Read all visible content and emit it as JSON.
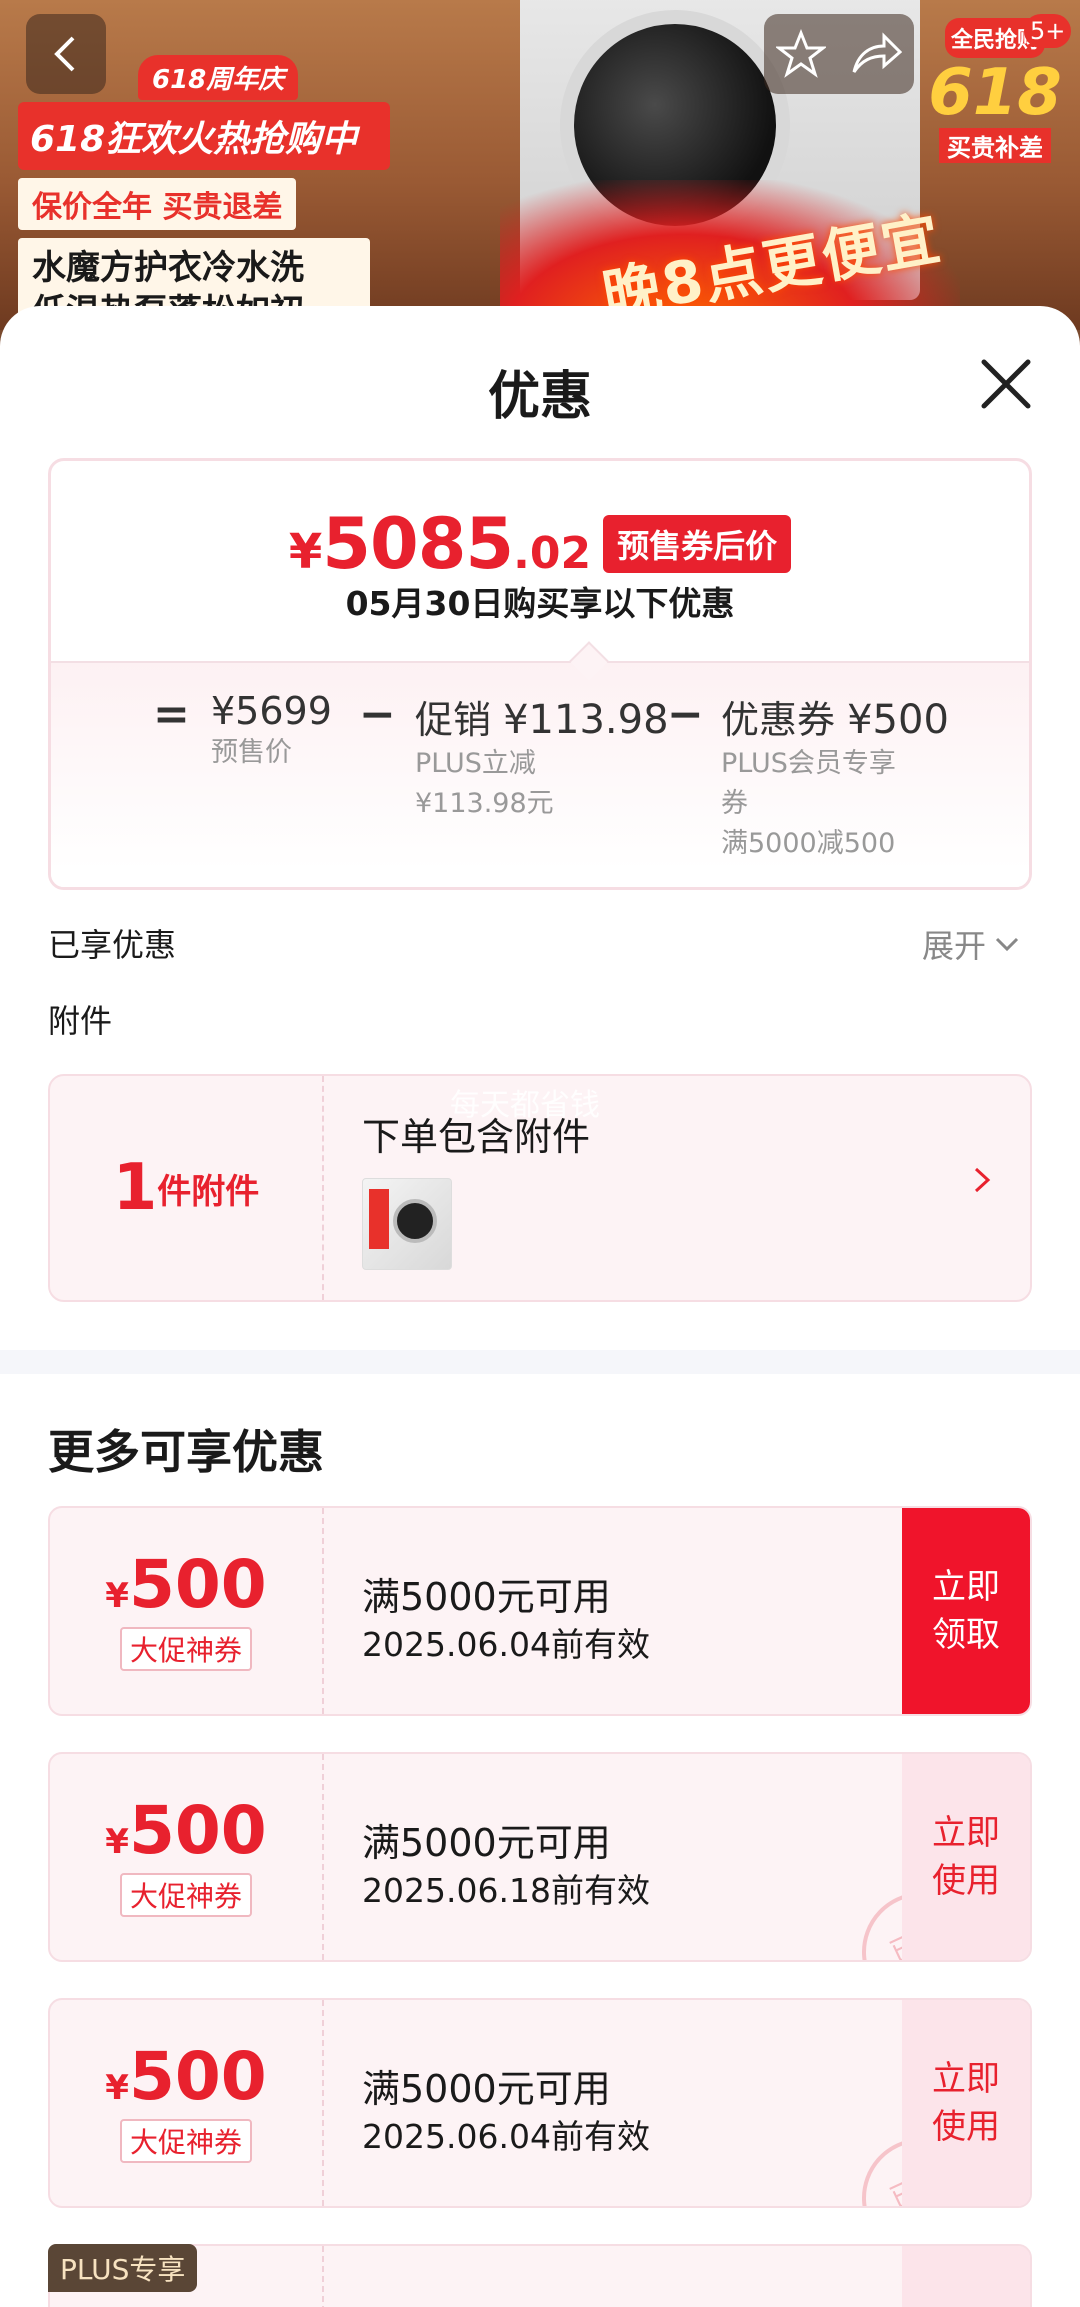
{
  "banner": {
    "promo_badge": "618周年庆",
    "promo_headline": "618狂欢火热抢购中",
    "promo_sub": "保价全年 买贵退差",
    "promo_feature_1": "水魔方护衣冷水洗",
    "promo_feature_2": "低温热泵蓬松如初",
    "flame_text": "晚8点更便宜",
    "event_line1": "全民抢购",
    "event_618": "618",
    "event_line3": "买贵补差",
    "notification_count": "5+",
    "icons": [
      "back-icon",
      "star-icon",
      "share-icon"
    ]
  },
  "sheet": {
    "title": "优惠",
    "close_icon": "close-icon"
  },
  "price_card": {
    "currency": "¥",
    "price_int": "5085",
    "price_dec": ".02",
    "price_tag": "预售券后价",
    "description": "05月30日购买享以下优惠",
    "equals": "=",
    "minus": "−",
    "presale_amount": "¥5699",
    "presale_label": "预售价",
    "promo_label": "促销",
    "promo_amount": "¥113.98",
    "promo_sub1": "PLUS立减",
    "promo_sub2": "¥113.98元",
    "coupon_label": "优惠券",
    "coupon_amount": "¥500",
    "coupon_sub1": "PLUS会员专享",
    "coupon_sub2": "券",
    "coupon_sub3": "满5000减500"
  },
  "enjoyed": {
    "label": "已享优惠",
    "expand_label": "展开"
  },
  "accessory": {
    "section_label": "附件",
    "count": "1",
    "unit": "件附件",
    "title": "下单包含附件",
    "watermark": "每天都省钱"
  },
  "more": {
    "title": "更多可享优惠",
    "plus_tag": "PLUS专享"
  },
  "coupons": [
    {
      "currency": "¥",
      "amount": "500",
      "label": "大促神券",
      "condition": "满5000元可用",
      "validity": "2025.06.04前有效",
      "action": "立即领取",
      "claimed": false
    },
    {
      "currency": "¥",
      "amount": "500",
      "label": "大促神券",
      "condition": "满5000元可用",
      "validity": "2025.06.18前有效",
      "action": "立即使用",
      "claimed": true,
      "stamp": "已领"
    },
    {
      "currency": "¥",
      "amount": "500",
      "label": "大促神券",
      "condition": "满5000元可用",
      "validity": "2025.06.04前有效",
      "action": "立即使用",
      "claimed": true,
      "stamp": "已领"
    }
  ],
  "colors": {
    "accent_red": "#e8212e",
    "claim_button": "#f0142b",
    "coupon_bg": "#fdf3f5",
    "plus_tag_bg": "#5a4636"
  }
}
